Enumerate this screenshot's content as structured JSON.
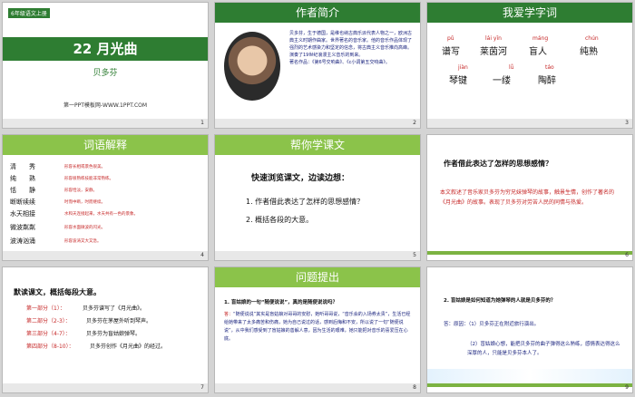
{
  "slide1": {
    "grade": "6年级语文上册",
    "title": "22 月光曲",
    "author": "贝多芬",
    "site": "第一PPT模板网-WWW.1PPT.COM",
    "num": "1"
  },
  "slide2": {
    "header": "作者简介",
    "bio": "贝多芬，生于德国，是维也纳古典乐派代表人物之一，欧洲古典主义时期作曲家。世界著名的音乐家。他的音乐作品体现了强烈的艺术感染力和坚定的信念，将古典主义音乐推向高峰。演奏了19世纪浪漫主义音乐的到来。",
    "works": "著名作品：《第6号交响曲》、《c小调第五交响曲》。",
    "num": "2"
  },
  "slide3": {
    "header": "我爱学字词",
    "row1_pinyin": [
      "pǔ",
      "lái yīn",
      "máng",
      "chún"
    ],
    "row1_chars": [
      "谱写",
      "莱茵河",
      "盲人",
      "纯熟"
    ],
    "row2_pinyin": [
      "jiàn",
      "lǚ",
      "táo"
    ],
    "row2_chars": [
      "琴键",
      "一缕",
      "陶醉"
    ],
    "num": "3"
  },
  "slide4": {
    "header": "词语解释",
    "items": [
      {
        "word": "清　　秀",
        "def": "形容长相或景色很美。"
      },
      {
        "word": "纯　　熟",
        "def": "形容很熟练技能非常熟练。"
      },
      {
        "word": "恬　　静",
        "def": "形容恬淡，安静。"
      },
      {
        "word": "断断续续",
        "def": "时而中断，时而继续。"
      },
      {
        "word": "水天相接",
        "def": "水和天连接起来，水天共有一色的景象。"
      },
      {
        "word": "微波粼粼",
        "def": "形容水面微波的闪光。"
      },
      {
        "word": "波涛汹涌",
        "def": "形容波涛又大又急。"
      }
    ],
    "num": "4"
  },
  "slide5": {
    "header": "帮你学课文",
    "heading": "快速浏览课文，边读边想：",
    "q1": "1. 作者借此表达了怎样的思想感情？",
    "q2": "2. 概括各段的大意。",
    "num": "5"
  },
  "slide6": {
    "question": "作者借此表达了怎样的思想感情？",
    "answer": "本文叙述了音乐家贝多芬为穷兄妹弹琴的故事，触景生情，创作了著名的《月光曲》的故事。表现了贝多芬对劳苦人民的同情与热爱。",
    "num": "6"
  },
  "slide7": {
    "heading": "默读课文，概括每段大意。",
    "parts": [
      {
        "label": "第一部分（1）：",
        "text": "贝多芬谱写了《月光曲》。"
      },
      {
        "label": "第二部分（2-3）：",
        "text": "贝多芬在茅屋外听到琴声。"
      },
      {
        "label": "第三部分（4-7）：",
        "text": "贝多芬为盲姑娘弹琴。"
      },
      {
        "label": "第四部分（8-10）：",
        "text": "贝多芬创作《月光曲》的经过。"
      }
    ],
    "num": "7"
  },
  "slide8": {
    "header": "问题提出",
    "q": "1. 盲姑娘的一句“随便说说”，真的是随便说说吗？",
    "a_label": "答：",
    "a": "“随便说说”其实是盲姑娘对哥哥的安慰，她听哥哥说，“音乐会的入场券太贵”，生活已经给她带来了太多痛苦和伤痛，她为自己说过的话，感到后悔和不安，所以说了一句“随便说说”，从中我们感受到了盲姑娘的善解人意，因为生活的艰难，她只能把对音乐的喜爱压在心底。",
    "num": "8"
  },
  "slide9": {
    "q": "2. 盲姑娘是如何知道为她弹琴的人就是贝多芬的？",
    "a1_label": "答：原因：",
    "a1": "（1）贝多芬正在附近旅行演出。",
    "a2": "（2）盲姑娘心想，能把贝多芬的曲子弹得这么熟练，感情表达得这么深厚的人，只能是贝多芬本人了。",
    "num": "9"
  }
}
